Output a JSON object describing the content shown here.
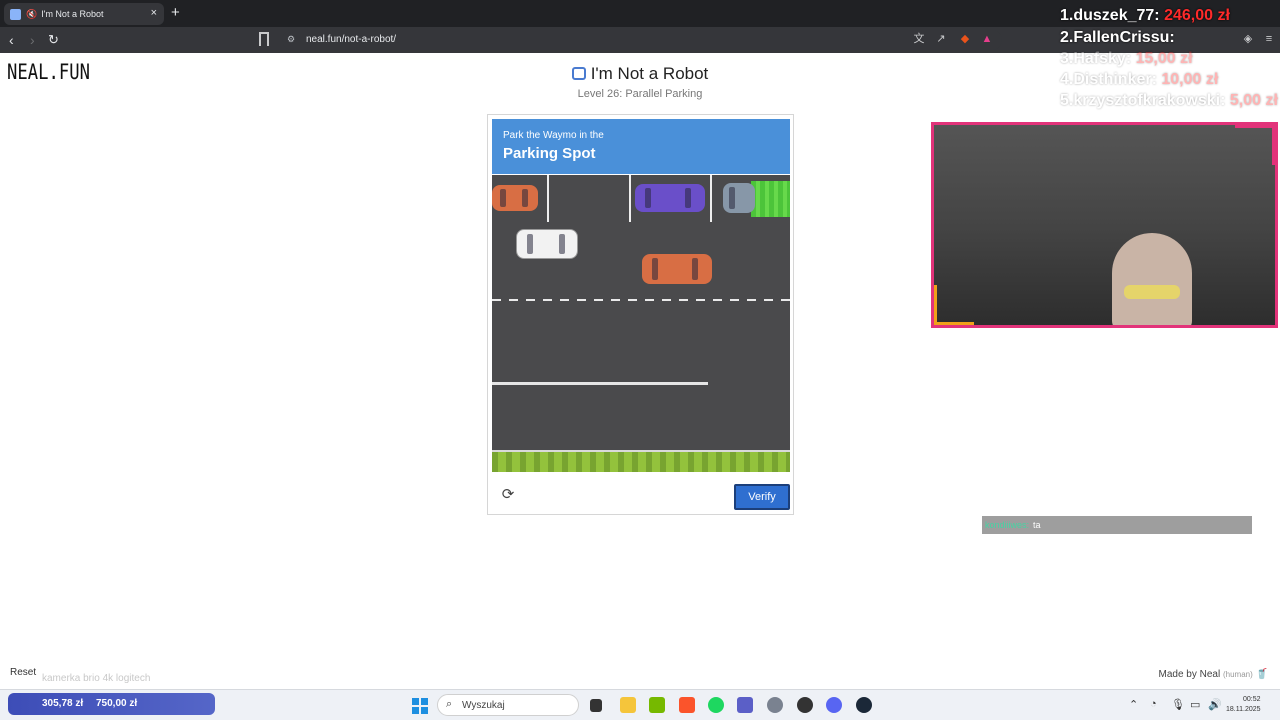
{
  "browser": {
    "tab_title": "I'm Not a Robot",
    "url": "neal.fun/not-a-robot/",
    "new_tab": "+",
    "close": "×"
  },
  "site": {
    "logo": "NEAL.FUN",
    "title": "I'm Not a Robot",
    "subtitle": "Level 26: Parallel Parking",
    "reset": "Reset",
    "made_by": "Made by Neal",
    "made_by_note": "(human)"
  },
  "captcha": {
    "instruction": "Park the Waymo in the",
    "target": "Parking Spot",
    "verify_label": "Verify",
    "refresh_icon": "refresh-icon"
  },
  "overlay": {
    "donations": [
      {
        "name": "1.duszek_77:",
        "amount": "246,00 zł"
      },
      {
        "name": "2.FallenCrissu:",
        "amount": ""
      },
      {
        "name": "3.Hafsky:",
        "amount": "15,00 zł"
      },
      {
        "name": "4.Disthinker:",
        "amount": "10,00 zł"
      },
      {
        "name": "5.krzysztofkrakowski:",
        "amount": "5,00 zł"
      }
    ],
    "chat_user": "kondiiiwes:",
    "chat_message": "ta",
    "webcam_caption": "kamerka brio 4k logitech",
    "goal_current": "305,78 zł",
    "goal_target": "750,00 zł"
  },
  "taskbar": {
    "search_placeholder": "Wyszukaj",
    "time": "00:52",
    "date": "18.11.2025"
  },
  "colors": {
    "accent": "#4a90d9",
    "verify": "#2f6fd0",
    "donation_amount": "#ff2a2a",
    "webcam_border": "#e2337a"
  }
}
